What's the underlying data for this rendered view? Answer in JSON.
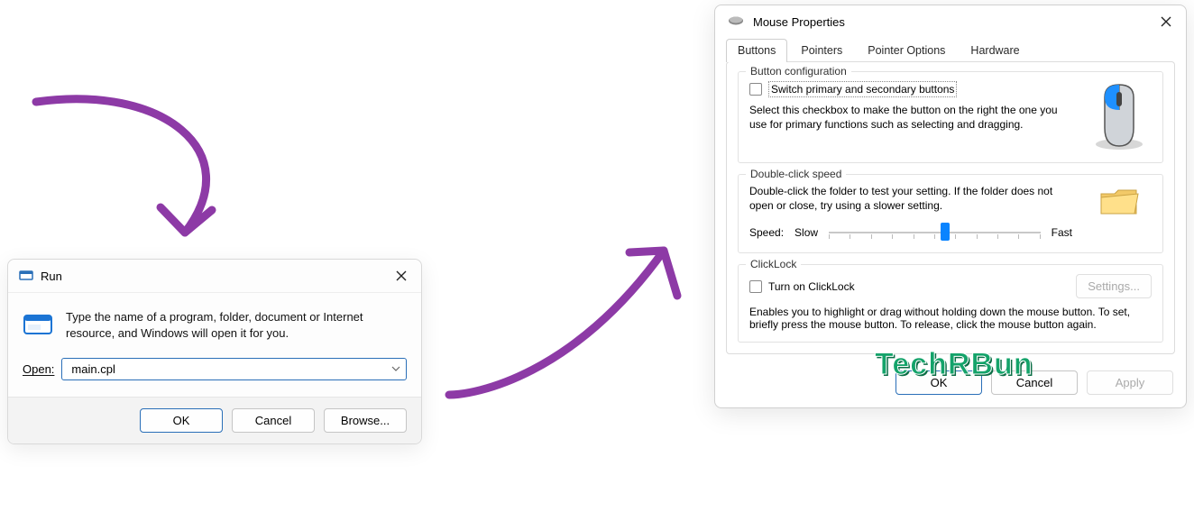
{
  "run": {
    "title": "Run",
    "description": "Type the name of a program, folder, document or Internet resource, and Windows will open it for you.",
    "open_label": "Open:",
    "open_value": "main.cpl",
    "ok": "OK",
    "cancel": "Cancel",
    "browse": "Browse..."
  },
  "mouse": {
    "title": "Mouse Properties",
    "tabs": [
      "Buttons",
      "Pointers",
      "Pointer Options",
      "Hardware"
    ],
    "active_tab": "Buttons",
    "button_config": {
      "group_title": "Button configuration",
      "checkbox_label": "Switch primary and secondary buttons",
      "desc": "Select this checkbox to make the button on the right the one you use for primary functions such as selecting and dragging."
    },
    "double_click": {
      "group_title": "Double-click speed",
      "desc": "Double-click the folder to test your setting. If the folder does not open or close, try using a slower setting.",
      "speed_label": "Speed:",
      "slow": "Slow",
      "fast": "Fast",
      "slider_percent": 55
    },
    "clicklock": {
      "group_title": "ClickLock",
      "checkbox_label": "Turn on ClickLock",
      "settings_btn": "Settings...",
      "desc": "Enables you to highlight or drag without holding down the mouse button. To set, briefly press the mouse button. To release, click the mouse button again."
    },
    "ok": "OK",
    "cancel": "Cancel",
    "apply": "Apply"
  },
  "watermark": "TechRBun"
}
